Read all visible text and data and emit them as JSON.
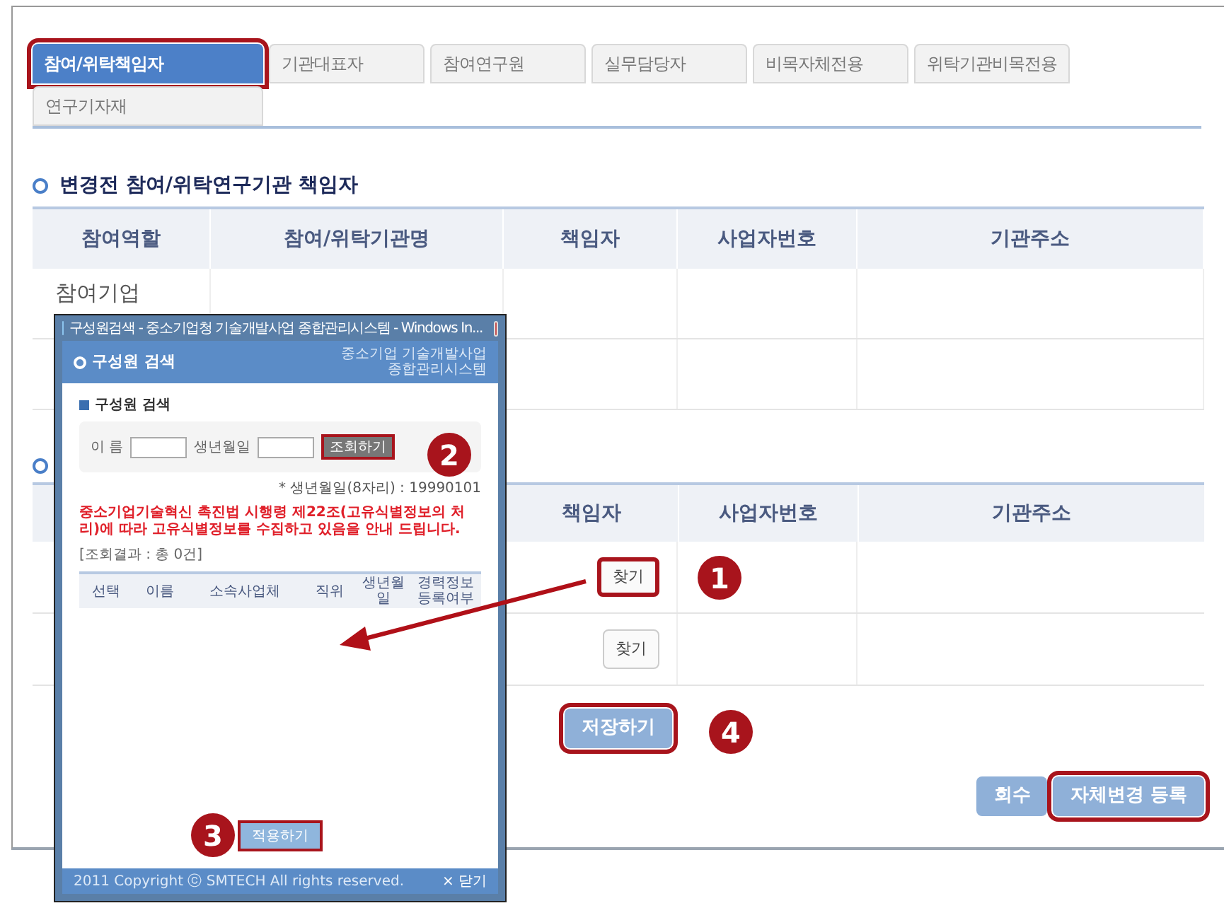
{
  "tabs": [
    {
      "label": "참여/위탁책임자",
      "selected": true
    },
    {
      "label": "기관대표자",
      "selected": false
    },
    {
      "label": "참여연구원",
      "selected": false
    },
    {
      "label": "실무담당자",
      "selected": false
    },
    {
      "label": "비목자체전용",
      "selected": false
    },
    {
      "label": "위탁기관비목전용",
      "selected": false
    },
    {
      "label": "연구기자재",
      "selected": false
    }
  ],
  "before_section": {
    "title": "변경전 참여/위탁연구기관 책임자",
    "columns": [
      "참여역할",
      "참여/위탁기관명",
      "책임자",
      "사업자번호",
      "기관주소"
    ],
    "rows": [
      [
        "참여기업"
      ]
    ]
  },
  "after_section": {
    "columns": [
      "책임자",
      "사업자번호",
      "기관주소"
    ],
    "rows": [
      {
        "find_button": "찾기",
        "highlighted": true
      },
      {
        "find_button": "찾기",
        "highlighted": false
      }
    ],
    "save_button": {
      "label": "저장하기",
      "highlighted": true
    }
  },
  "footer_buttons": [
    {
      "label": "회수",
      "highlighted": false
    },
    {
      "label": "자체변경 등록",
      "highlighted": true
    }
  ],
  "popup": {
    "window_title": "구성원검색 - 중소기업청 기술개발사업 종합관리시스템 - Windows In...",
    "header_title": "구성원 검색",
    "logo_text": "중소기업 기술개발사업 종합관리시스템",
    "section_title": "구성원 검색",
    "fields": [
      {
        "label": "이 름"
      },
      {
        "label": "생년월일"
      }
    ],
    "search_button": {
      "label": "조회하기",
      "highlighted": true
    },
    "hint": "* 생년월일(8자리) : 19990101",
    "notice": "중소기업기술혁신 촉진법 시행령 제22조(고유식별정보의 처리)에 따라 고유식별정보를 수집하고 있음을 안내 드립니다.",
    "result_count": "[조회결과 : 총 0건]",
    "columns": [
      "선택",
      "이름",
      "소속사업체",
      "직위",
      "생년월일",
      "경력정보 등록여부"
    ],
    "apply_button": {
      "label": "적용하기",
      "highlighted": true
    },
    "copyright": "2011 Copyright ⓒ SMTECH All rights reserved.",
    "close_button": "× 닫기"
  },
  "markers": [
    "1",
    "2",
    "3",
    "4"
  ]
}
